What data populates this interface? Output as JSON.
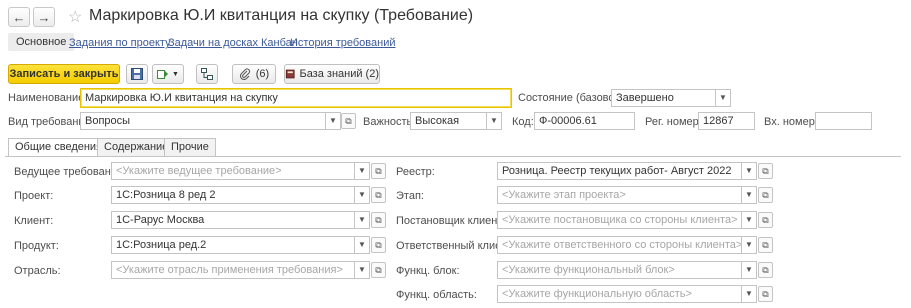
{
  "window": {
    "back_glyph": "←",
    "forward_glyph": "→",
    "star_glyph": "☆",
    "title": "Маркировка Ю.И квитанция на скупку (Требование)"
  },
  "nav_tabs": {
    "main": "Основное",
    "project_tasks": "Задания по проекту",
    "kanban_tasks": "Задачи на досках Канбан",
    "history": "История требований"
  },
  "toolbar": {
    "save_close": "Записать и закрыть",
    "save_icon": "floppy-icon",
    "create_based": "create-based-on-icon",
    "structure_icon": "structure-icon",
    "attachments_count": "(6)",
    "knowledge_base": "База знаний (2)"
  },
  "header_fields": {
    "name_label": "Наименование:",
    "name_value": "Маркировка Ю.И квитанция на скупку",
    "state_label": "Состояние (базовое):",
    "state_value": "Завершено",
    "type_label": "Вид требования:",
    "type_value": "Вопросы",
    "importance_label": "Важность:",
    "importance_value": "Высокая",
    "code_label": "Код:",
    "code_value": "Ф-00006.61",
    "reg_label": "Рег. номер:",
    "reg_value": "12867",
    "in_label": "Вх. номер:",
    "in_value": ""
  },
  "form_tabs": {
    "general": "Общие сведения",
    "content": "Содержание",
    "other": "Прочие"
  },
  "left_fields": {
    "lead_label": "Ведущее требование:",
    "lead_placeholder": "<Укажите ведущее требование>",
    "project_label": "Проект:",
    "project_value": "1С:Розница 8 ред 2",
    "client_label": "Клиент:",
    "client_value": "1С-Рарус Москва",
    "product_label": "Продукт:",
    "product_value": "1С:Розница ред.2",
    "industry_label": "Отрасль:",
    "industry_placeholder": "<Укажите отрасль применения требования>"
  },
  "right_fields": {
    "registry_label": "Реестр:",
    "registry_value": "Розница. Реестр текущих работ- Август 2022",
    "stage_label": "Этап:",
    "stage_placeholder": "<Укажите этап проекта>",
    "client_setter_label": "Постановщик клиента:",
    "client_setter_placeholder": "<Укажите постановщика со стороны клиента>",
    "client_resp_label": "Ответственный клиента:",
    "client_resp_placeholder": "<Укажите ответственного со стороны клиента>",
    "func_block_label": "Функц. блок:",
    "func_block_placeholder": "<Укажите функциональный блок>",
    "func_area_label": "Функц. область:",
    "func_area_placeholder": "<Укажите функциональную область>"
  },
  "glyphs": {
    "dropdown": "▼",
    "open": "⧉"
  }
}
